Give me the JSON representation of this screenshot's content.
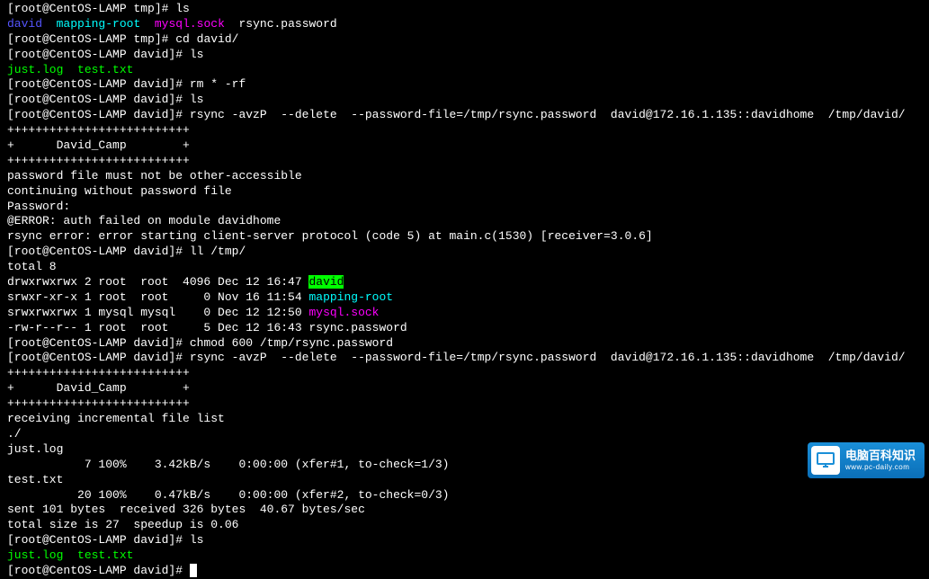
{
  "l1_prompt": "[root@CentOS-LAMP tmp]# ",
  "l1_cmd": "ls",
  "l2_a": "david",
  "l2_b": "mapping-root",
  "l2_c": "mysql.sock",
  "l2_d": "rsync.password",
  "l3_prompt": "[root@CentOS-LAMP tmp]# ",
  "l3_cmd": "cd david/",
  "l4_prompt": "[root@CentOS-LAMP david]# ",
  "l4_cmd": "ls",
  "l5_a": "just.log",
  "l5_b": "test.txt",
  "l6_prompt": "[root@CentOS-LAMP david]# ",
  "l6_cmd": "rm * -rf",
  "l7_prompt": "[root@CentOS-LAMP david]# ",
  "l7_cmd": "ls",
  "l8_prompt": "[root@CentOS-LAMP david]# ",
  "l8_cmd": "rsync -avzP  --delete  --password-file=/tmp/rsync.password  david@172.16.1.135::davidhome  /tmp/david/",
  "l9": "++++++++++++++++++++++++++",
  "l10": "+      David_Camp        +",
  "l11": "++++++++++++++++++++++++++",
  "l12": "",
  "l13": "password file must not be other-accessible",
  "l14": "continuing without password file",
  "l15": "Password:",
  "l16": "@ERROR: auth failed on module davidhome",
  "l17": "rsync error: error starting client-server protocol (code 5) at main.c(1530) [receiver=3.0.6]",
  "l18_prompt": "[root@CentOS-LAMP david]# ",
  "l18_cmd": "ll /tmp/",
  "l19": "total 8",
  "l20_a": "drwxrwxrwx 2 root  root  4096 Dec 12 16:47 ",
  "l20_b": "david",
  "l21_a": "srwxr-xr-x 1 root  root     0 Nov 16 11:54 ",
  "l21_b": "mapping-root",
  "l22_a": "srwxrwxrwx 1 mysql mysql    0 Dec 12 12:50 ",
  "l22_b": "mysql.sock",
  "l23_a": "-rw-r--r-- 1 root  root     5 Dec 12 16:43 rsync.password",
  "l24_prompt": "[root@CentOS-LAMP david]# ",
  "l24_cmd": "chmod 600 /tmp/rsync.password",
  "l25_prompt": "[root@CentOS-LAMP david]# ",
  "l25_cmd": "rsync -avzP  --delete  --password-file=/tmp/rsync.password  david@172.16.1.135::davidhome  /tmp/david/",
  "l26": "++++++++++++++++++++++++++",
  "l27": "+      David_Camp        +",
  "l28": "++++++++++++++++++++++++++",
  "l29": "",
  "l30": "receiving incremental file list",
  "l31": "./",
  "l32": "just.log",
  "l33": "           7 100%    3.42kB/s    0:00:00 (xfer#1, to-check=1/3)",
  "l34": "test.txt",
  "l35": "          20 100%    0.47kB/s    0:00:00 (xfer#2, to-check=0/3)",
  "l36": "",
  "l37": "sent 101 bytes  received 326 bytes  40.67 bytes/sec",
  "l38": "total size is 27  speedup is 0.06",
  "l39_prompt": "[root@CentOS-LAMP david]# ",
  "l39_cmd": "ls",
  "l40_a": "just.log",
  "l40_b": "test.txt",
  "l41_prompt": "[root@CentOS-LAMP david]# ",
  "watermark_cn": "电脑百科知识",
  "watermark_en": "www.pc-daily.com"
}
